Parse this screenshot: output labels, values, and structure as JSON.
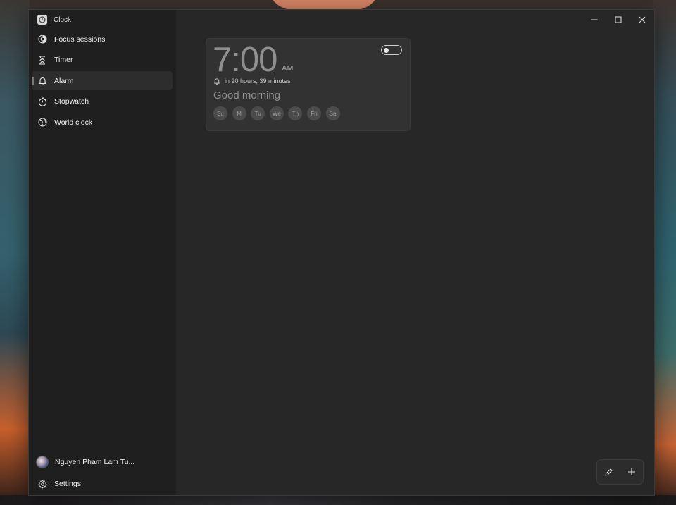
{
  "app": {
    "title": "Clock",
    "icon": "clock-app-icon"
  },
  "sidebar": {
    "items": [
      {
        "label": "Focus sessions",
        "icon": "focus-icon",
        "selected": false
      },
      {
        "label": "Timer",
        "icon": "hourglass-icon",
        "selected": false
      },
      {
        "label": "Alarm",
        "icon": "bell-icon",
        "selected": true
      },
      {
        "label": "Stopwatch",
        "icon": "stopwatch-icon",
        "selected": false
      },
      {
        "label": "World clock",
        "icon": "globe-icon",
        "selected": false
      }
    ],
    "account": {
      "name": "Nguyen Pham Lam Tu...",
      "icon": "avatar"
    },
    "settings": {
      "label": "Settings",
      "icon": "gear-icon"
    }
  },
  "window_controls": {
    "minimize": "minimize-icon",
    "maximize": "maximize-icon",
    "close": "close-icon"
  },
  "alarm": {
    "time": "7:00",
    "ampm": "AM",
    "remaining": "in 20 hours, 39 minutes",
    "name": "Good morning",
    "enabled": false,
    "days": [
      "Su",
      "M",
      "Tu",
      "We",
      "Th",
      "Fri",
      "Sa"
    ]
  },
  "actions": {
    "edit": "pencil-icon",
    "add": "plus-icon"
  },
  "colors": {
    "window_bg": "#202020",
    "main_bg": "#272727",
    "card_bg": "#323232",
    "text_primary": "#f2f2f2",
    "text_muted": "#8f8f8f"
  }
}
